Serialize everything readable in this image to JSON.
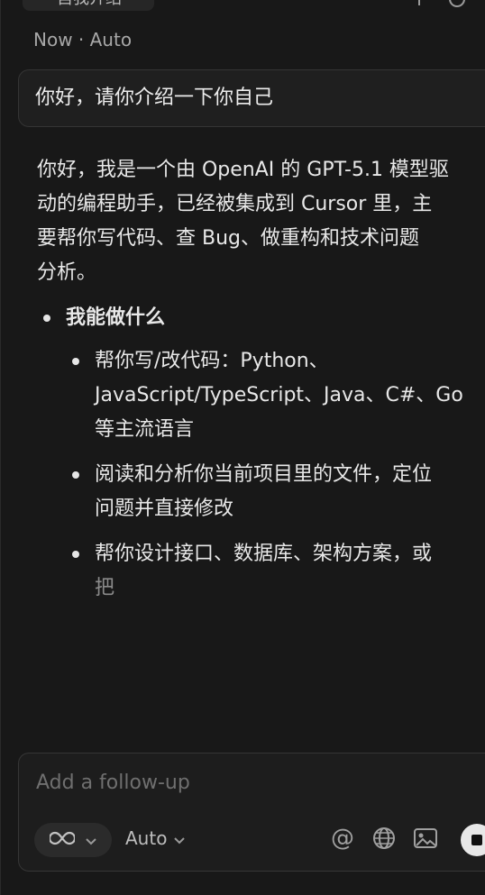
{
  "header": {
    "title_partial": "自我介绍",
    "icons": [
      "plus-icon",
      "history-icon"
    ]
  },
  "message_meta": "Now · Auto",
  "user_message": "你好，请你介绍一下你自己",
  "assistant": {
    "intro": "你好，我是一个由 OpenAI 的 GPT-5.1 模型驱\n动的编程助手，已经被集成到 Cursor 里，主\n要帮你写代码、查 Bug、做重构和技术问题\n分析。",
    "list_title": "我能做什么",
    "items": [
      "帮你写/改代码：Python、\nJavaScript/TypeScript、Java、C#、Go\n等主流语言",
      "阅读和分析你当前项目里的文件，定位\n问题并直接修改",
      "帮你设计接口、数据库、架构方案，或"
    ],
    "streaming_tail": "把"
  },
  "composer": {
    "placeholder": "Add a follow-up",
    "value": "",
    "mode_icon": "infinity-icon",
    "model_label": "Auto",
    "tools": [
      "at-mention-icon",
      "globe-icon",
      "image-icon"
    ],
    "send_state": "stop"
  },
  "colors": {
    "background": "#181818",
    "panel": "#1d1d1d",
    "border": "#363636",
    "text": "#e6e6e6",
    "muted": "#a7a7a7",
    "placeholder": "#6f6f6f"
  }
}
